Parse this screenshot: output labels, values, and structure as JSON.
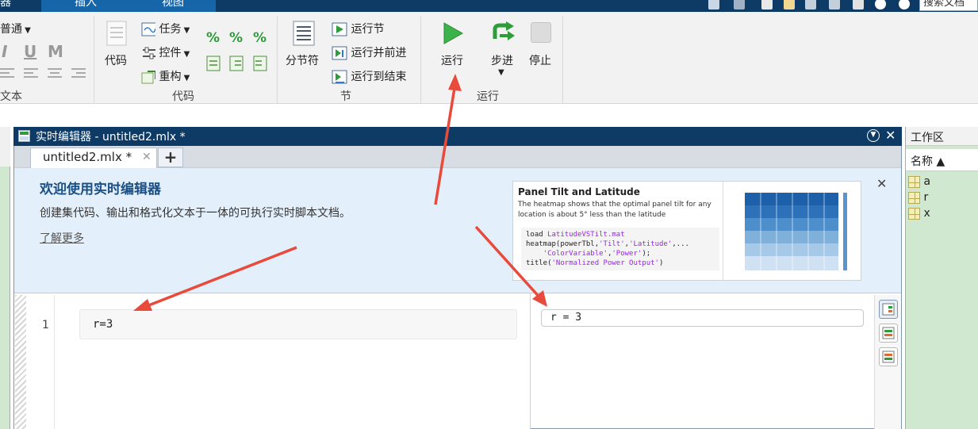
{
  "tabs": {
    "first": "器",
    "insert": "插入",
    "view": "视图"
  },
  "search": {
    "placeholder": "搜索文档"
  },
  "ribbon": {
    "text_group": {
      "style_dropdown": "普通",
      "label": "文本",
      "italic": "I",
      "underline": "U",
      "mono": "M"
    },
    "code_group": {
      "code_button": "代码",
      "task": "任务",
      "control": "控件",
      "refactor": "重构",
      "label": "代码"
    },
    "section_group": {
      "section_break": "分节符",
      "run_section": "运行节",
      "run_and_advance": "运行并前进",
      "run_to_end": "运行到结束",
      "label": "节"
    },
    "run_group": {
      "run": "运行",
      "step": "步进",
      "stop": "停止",
      "label": "运行"
    }
  },
  "editor": {
    "title": "实时编辑器 - untitled2.mlx *",
    "file_tab": "untitled2.mlx *",
    "add_tab": "+",
    "welcome": {
      "heading": "欢迎使用实时编辑器",
      "description": "创建集代码、输出和格式化文本于一体的可执行实时脚本文档。",
      "learn_more": "了解更多"
    },
    "preview": {
      "title": "Panel Tilt and Latitude",
      "text": "The heatmap shows that the optimal panel tilt for any location is about 5° less than the latitude",
      "code_lines": [
        "load LatitudeVSTilt.mat",
        "heatmap(powerTbl,'Tilt','Latitude',...",
        "    'ColorVariable','Power');",
        "title('Normalized Power Output')"
      ]
    },
    "line_number": "1",
    "code": "r=3",
    "output": "r = 3"
  },
  "workspace": {
    "title": "工作区",
    "column": "名称 ▲",
    "variables": [
      "a",
      "r",
      "x"
    ]
  },
  "colors": {
    "title_bar": "#0d3b66",
    "tab_active": "#1565a8",
    "welcome_bg": "#e3effa",
    "arrow": "#e84a3c",
    "workspace_bg": "#cfe8cf"
  }
}
